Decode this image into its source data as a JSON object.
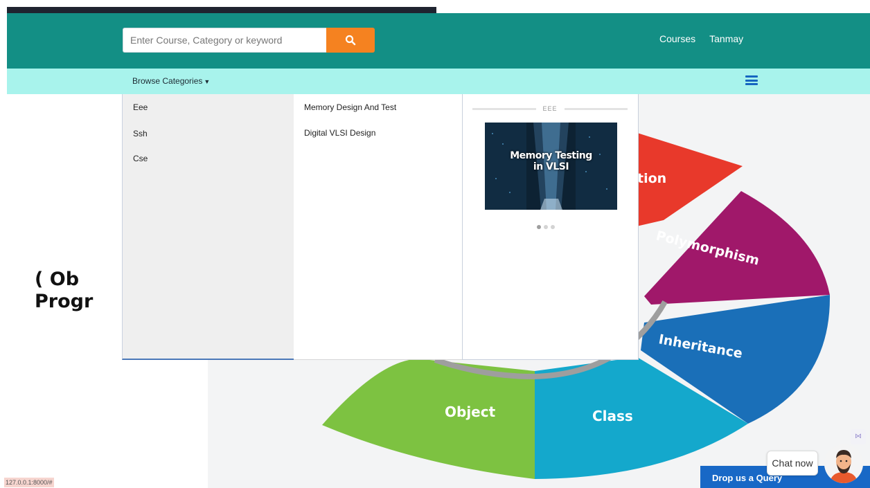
{
  "header": {
    "search_placeholder": "Enter Course, Category or keyword",
    "nav_courses": "Courses",
    "nav_user": "Tanmay",
    "accent_color": "#138f85",
    "search_button_color": "#f58220"
  },
  "subnav": {
    "browse_label": "Browse Categories",
    "accent_color": "#a8f3ec"
  },
  "mega_menu": {
    "categories": [
      "Eee",
      "Ssh",
      "Cse"
    ],
    "subcategories": [
      "Memory Design And Test",
      "Digital VLSI Design"
    ],
    "promo": {
      "label": "EEE",
      "course_title_line1": "Memory Testing",
      "course_title_line2": "in VLSI",
      "carousel_count": 3,
      "carousel_active": 1
    }
  },
  "hero": {
    "title_line1": "( Ob",
    "title_line2": "Progr",
    "wheel_segments": [
      {
        "label": "Object",
        "color": "#7dc241"
      },
      {
        "label": "Class",
        "color": "#14a8cc"
      },
      {
        "label": "Inheritance",
        "color": "#1a6fb8"
      },
      {
        "label": "Polymorphism",
        "color": "#a0186a"
      },
      {
        "label": "tion",
        "color": "#e8392b"
      }
    ]
  },
  "status": {
    "url": "127.0.0.1:8000/#"
  },
  "chat": {
    "bubble": "Chat now",
    "query_button": "Drop us a Query",
    "query_color": "#1868c6"
  }
}
